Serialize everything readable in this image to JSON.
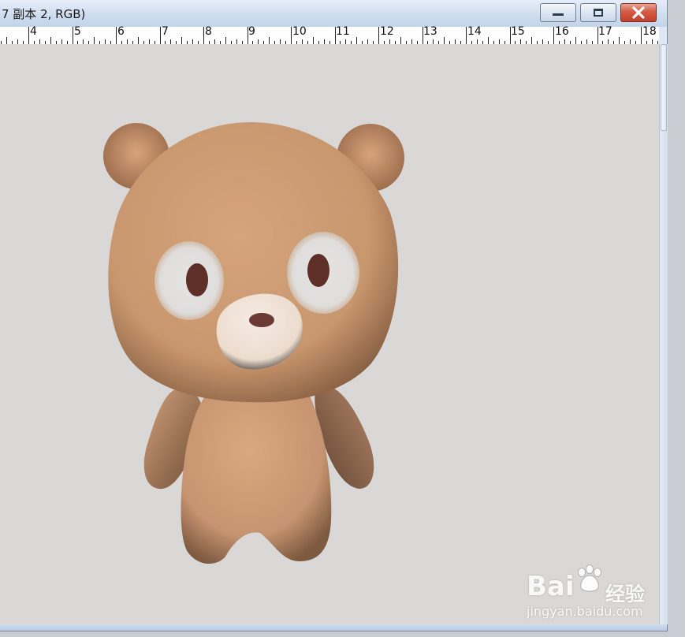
{
  "window": {
    "title": "7 副本 2, RGB)",
    "controls": {
      "minimize": "minimize-icon",
      "maximize": "maximize-icon",
      "close": "close-icon"
    }
  },
  "ruler": {
    "labels": [
      "4",
      "5",
      "6",
      "7",
      "8",
      "9",
      "10",
      "11",
      "12",
      "13",
      "14",
      "15",
      "16",
      "17",
      "18"
    ]
  },
  "canvas": {
    "background": "#d9d8d6",
    "image": "teddy-bear-3d-model",
    "colors": {
      "fur": "#c9976e",
      "eyes_patch": "#e6e6e4",
      "pupil": "#5e2f26",
      "muzzle": "#f1e4da",
      "nose": "#6a3a33"
    }
  },
  "watermark": {
    "brand": "Bai",
    "paw_icon": "paw-icon",
    "brand_suffix": "经验",
    "url": "jingyan.baidu.com"
  }
}
